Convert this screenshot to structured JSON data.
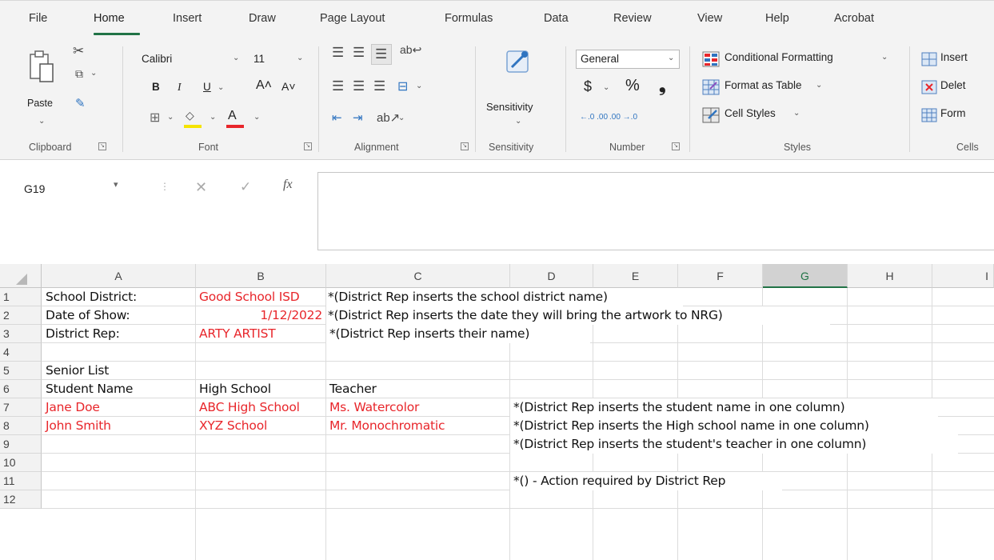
{
  "tabs": [
    "File",
    "Home",
    "Insert",
    "Draw",
    "Page Layout",
    "Formulas",
    "Data",
    "Review",
    "View",
    "Help",
    "Acrobat"
  ],
  "ribbon": {
    "clipboard": {
      "paste": "Paste",
      "label": "Clipboard"
    },
    "font": {
      "name": "Calibri",
      "size": "11",
      "bold": "B",
      "italic": "I",
      "underline": "U",
      "grow": "A˄",
      "shrink": "A˅",
      "color_letter": "A",
      "label": "Font"
    },
    "alignment": {
      "label": "Alignment"
    },
    "sensitivity": {
      "button": "Sensitivity",
      "label": "Sensitivity"
    },
    "number": {
      "format": "General",
      "currency": "$",
      "percent": "%",
      "comma": "❟",
      "inc_decimal": "←.0 .00",
      "dec_decimal": ".00 →.0",
      "label": "Number"
    },
    "styles": {
      "conditional": "Conditional Formatting",
      "table": "Format as Table",
      "cell_styles": "Cell Styles",
      "label": "Styles"
    },
    "cells": {
      "insert": "Insert",
      "delete": "Delet",
      "format": "Form",
      "label": "Cells"
    }
  },
  "formula_bar": {
    "name_box": "G19",
    "fx": "fx",
    "formula": ""
  },
  "columns": [
    "A",
    "B",
    "C",
    "D",
    "E",
    "F",
    "G",
    "H",
    "I"
  ],
  "rows": [
    "1",
    "2",
    "3",
    "4",
    "5",
    "6",
    "7",
    "8",
    "9",
    "10",
    "11",
    "12"
  ],
  "cells": {
    "A1": "School District:",
    "B1": "Good School ISD",
    "C1": "*(District Rep inserts the school district name)",
    "A2": "Date of Show:",
    "B2": "1/12/2022",
    "C2": "*(District Rep inserts the date they will bring the artwork to NRG)",
    "A3": "District Rep:",
    "B3": "ARTY ARTIST",
    "C3": "*(District Rep inserts their name)",
    "A5": "Senior List",
    "A6": "Student Name",
    "B6": "High School",
    "C6": "Teacher",
    "A7": "Jane Doe",
    "B7": "ABC High School",
    "C7": "Ms. Watercolor",
    "D7": "*(District Rep inserts the student name in one column)",
    "A8": "John Smith",
    "B8": "XYZ School",
    "C8": "Mr. Monochromatic",
    "D8": "*(District Rep inserts the High school name in one column)",
    "D9": "*(District Rep inserts  the student's teacher in one column)",
    "D11": "*() - Action required by District Rep"
  },
  "colors": {
    "accent": "#217346",
    "input_red": "#e8262b"
  }
}
